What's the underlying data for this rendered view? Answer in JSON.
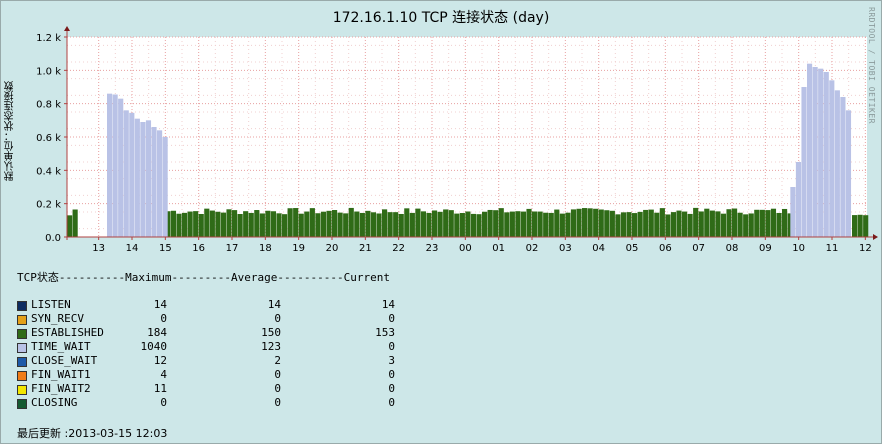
{
  "window_title": "172.16.1.10 TCP 连接状态 (day)",
  "watermark": "RRDTOOL / TOBI OETIKER",
  "legend_header": "TCP状态----------Maximum---------Average----------Current",
  "last_update": "最后更新 :2013-03-15 12:03",
  "legend": [
    {
      "name": "LISTEN",
      "max": "14",
      "avg": "14",
      "cur": "14",
      "color": "#0d2c61"
    },
    {
      "name": "SYN_RECV",
      "max": "0",
      "avg": "0",
      "cur": "0",
      "color": "#e5a019"
    },
    {
      "name": "ESTABLISHED",
      "max": "184",
      "avg": "150",
      "cur": "153",
      "color": "#2f6b17"
    },
    {
      "name": "TIME_WAIT",
      "max": "1040",
      "avg": "123",
      "cur": "0",
      "color": "#b9c2e6"
    },
    {
      "name": "CLOSE_WAIT",
      "max": "12",
      "avg": "2",
      "cur": "3",
      "color": "#1e5aa8"
    },
    {
      "name": "FIN_WAIT1",
      "max": "4",
      "avg": "0",
      "cur": "0",
      "color": "#f07c18"
    },
    {
      "name": "FIN_WAIT2",
      "max": "11",
      "avg": "0",
      "cur": "0",
      "color": "#f2e600"
    },
    {
      "name": "CLOSING",
      "max": "0",
      "avg": "0",
      "cur": "0",
      "color": "#155a31"
    }
  ],
  "chart_data": {
    "type": "bar",
    "title": "172.16.1.10 TCP 连接状态 (day)",
    "ylabel": "默认单位：状态连接数",
    "xlabel": "",
    "ylim": [
      0,
      1200
    ],
    "yticks": [
      {
        "v": 0,
        "label": "0.0"
      },
      {
        "v": 200,
        "label": "0.2 k"
      },
      {
        "v": 400,
        "label": "0.4 k"
      },
      {
        "v": 600,
        "label": "0.6 k"
      },
      {
        "v": 800,
        "label": "0.8 k"
      },
      {
        "v": 1000,
        "label": "1.0 k"
      },
      {
        "v": 1200,
        "label": "1.2 k"
      }
    ],
    "x_start_hour": 12.05,
    "x_end_hour": 36.05,
    "x_tick_labels": [
      "13",
      "14",
      "15",
      "16",
      "17",
      "18",
      "19",
      "20",
      "21",
      "22",
      "23",
      "00",
      "01",
      "02",
      "03",
      "04",
      "05",
      "06",
      "07",
      "08",
      "09",
      "10",
      "11",
      "12"
    ],
    "grid": true,
    "stacked": true,
    "bin_minutes": 10,
    "series": [
      {
        "name": "ESTABLISHED",
        "color": "#2f6b17",
        "segments": [
          {
            "from": 12.05,
            "to": 12.35,
            "values": [
              130,
              160,
              165,
              150
            ]
          },
          {
            "from": 15.0,
            "to": 33.75,
            "level": 155,
            "jitter": 20
          },
          {
            "from": 35.6,
            "to": 36.05,
            "level": 150,
            "jitter": 20
          }
        ]
      },
      {
        "name": "TIME_WAIT",
        "color": "#b9c2e6",
        "segments": [
          {
            "from": 13.25,
            "to": 15.0,
            "values": [
              860,
              855,
              860,
              830,
              800,
              760,
              750,
              745,
              740,
              710,
              690,
              670,
              700,
              660,
              660,
              650,
              640,
              620,
              600,
              635
            ]
          },
          {
            "from": 33.75,
            "to": 35.5,
            "values": [
              300,
              450,
              780,
              900,
              980,
              1040,
              1030,
              1020,
              1020,
              1010,
              990,
              970,
              940,
              900,
              880,
              860,
              840,
              800,
              760,
              720
            ]
          }
        ]
      }
    ]
  }
}
